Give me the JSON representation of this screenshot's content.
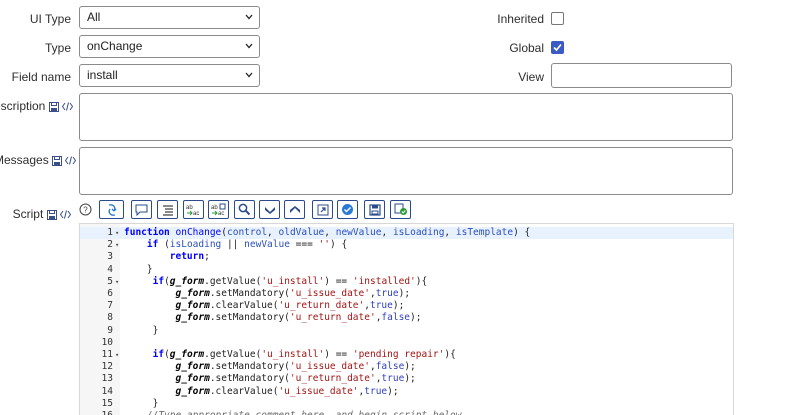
{
  "form": {
    "ui_type": {
      "label": "UI Type",
      "value": "All"
    },
    "type": {
      "label": "Type",
      "value": "onChange"
    },
    "field_name": {
      "label": "Field name",
      "value": "install"
    },
    "inherited": {
      "label": "Inherited",
      "checked": false
    },
    "global": {
      "label": "Global",
      "checked": true
    },
    "view": {
      "label": "View",
      "value": ""
    },
    "description": {
      "label": "escription",
      "value": ""
    },
    "messages": {
      "label": "Messages",
      "value": ""
    },
    "script": {
      "label": "Script"
    }
  },
  "toolbar": {
    "buttons": [
      "help-icon",
      "toggle-syntax-icon",
      "comment-icon",
      "format-code-icon",
      "replace-icon",
      "replace-all-icon",
      "search-icon",
      "find-next-icon",
      "find-previous-icon",
      "fullscreen-icon",
      "script-debugger-icon",
      "save-icon",
      "check-syntax-icon"
    ]
  },
  "script_lines": [
    {
      "n": "1",
      "fold": true,
      "text": "function onChange(control, oldValue, newValue, isLoading, isTemplate) {"
    },
    {
      "n": "2",
      "fold": true,
      "text": "    if (isLoading || newValue === '') {"
    },
    {
      "n": "3",
      "fold": false,
      "text": "        return;"
    },
    {
      "n": "4",
      "fold": false,
      "text": "    }"
    },
    {
      "n": "5",
      "fold": true,
      "text": "     if(g_form.getValue('u_install') == 'installed'){"
    },
    {
      "n": "6",
      "fold": false,
      "text": "         g_form.setMandatory('u_issue_date',true);"
    },
    {
      "n": "7",
      "fold": false,
      "text": "         g_form.clearValue('u_return_date',true);"
    },
    {
      "n": "8",
      "fold": false,
      "text": "         g_form.setMandatory('u_return_date',false);"
    },
    {
      "n": "9",
      "fold": false,
      "text": "     }"
    },
    {
      "n": "10",
      "fold": false,
      "text": ""
    },
    {
      "n": "11",
      "fold": true,
      "text": "     if(g_form.getValue('u_install') == 'pending repair'){"
    },
    {
      "n": "12",
      "fold": false,
      "text": "         g_form.setMandatory('u_issue_date',false);"
    },
    {
      "n": "13",
      "fold": false,
      "text": "         g_form.setMandatory('u_return_date',true);"
    },
    {
      "n": "14",
      "fold": false,
      "text": "         g_form.clearValue('u_issue_date',true);"
    },
    {
      "n": "15",
      "fold": false,
      "text": "     }"
    },
    {
      "n": "16",
      "fold": false,
      "text": "    //Type appropriate comment here, and begin script below"
    }
  ]
}
